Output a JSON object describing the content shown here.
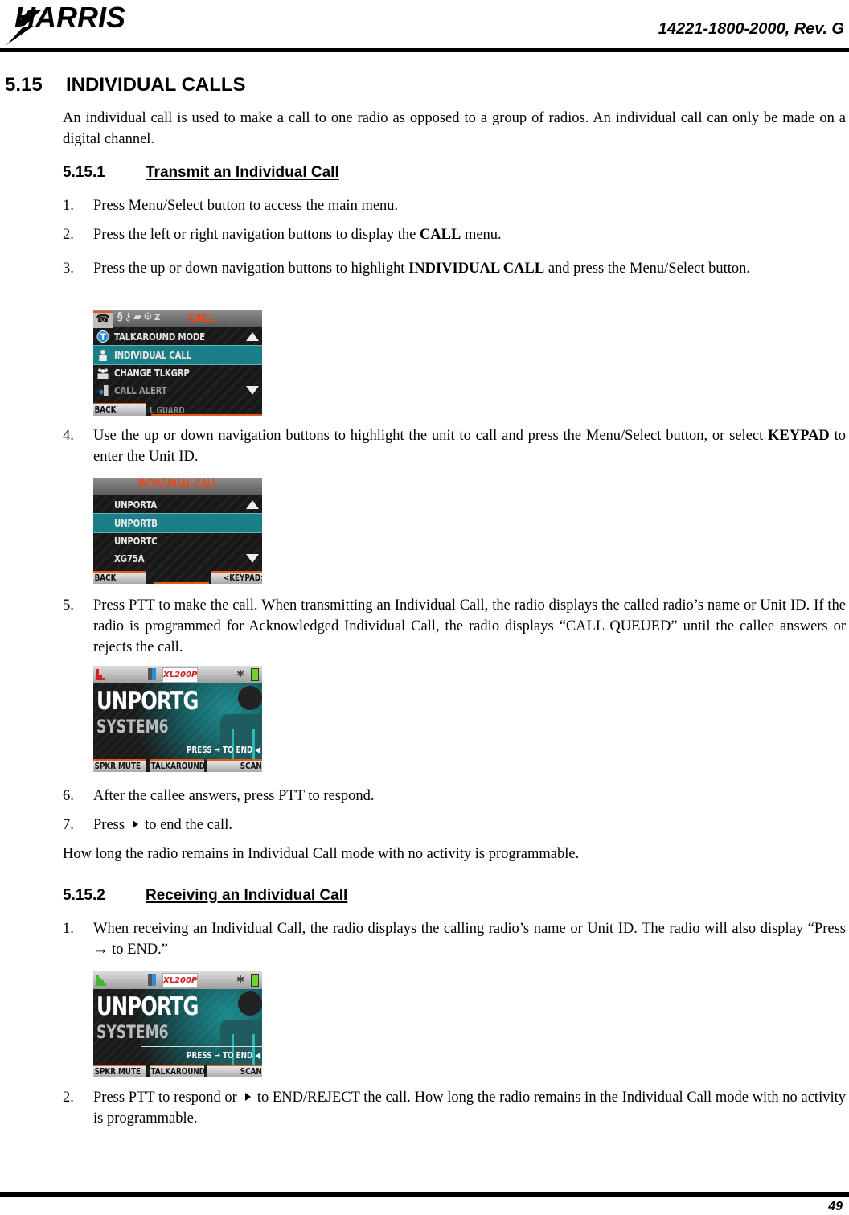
{
  "header": {
    "logo_text": "HARRIS",
    "doc_number": "14221-1800-2000, Rev. G"
  },
  "footer": {
    "page_number": "49"
  },
  "section": {
    "number": "5.15",
    "title": "INDIVIDUAL CALLS",
    "intro": "An individual call is used to make a call to one radio as opposed to a group of radios. An individual call can only be made on a digital channel."
  },
  "transmit": {
    "number": "5.15.1",
    "title": "Transmit an Individual Call",
    "steps": [
      {
        "n": "1.",
        "text": "Press Menu/Select button to access the main menu."
      },
      {
        "n": "2.",
        "pre": "Press the left or right navigation buttons to display the ",
        "bold": "CALL",
        "post": " menu."
      },
      {
        "n": "3.",
        "pre": "Press the up or down navigation buttons to highlight ",
        "bold": "INDIVIDUAL CALL",
        "post": " and press the Menu/Select button."
      },
      {
        "n": "4.",
        "pre": "Use the up or down navigation buttons to highlight the unit to call and press the Menu/Select button, or select ",
        "bold": "KEYPAD",
        "post": " to enter the Unit ID."
      },
      {
        "n": "5.",
        "text": "Press PTT to make the call.  When transmitting an Individual Call, the radio displays the called radio’s name or Unit ID. If the radio is programmed for Acknowledged Individual Call, the radio displays “CALL QUEUED” until the callee answers or rejects the call."
      },
      {
        "n": "6.",
        "text": "After the callee answers, press PTT to respond."
      },
      {
        "n": "7.",
        "pre": "Press",
        "post": "to end the call."
      }
    ],
    "note": "How long the radio remains in Individual Call mode with no activity is programmable."
  },
  "receive": {
    "number": "5.15.2",
    "title": "Receiving an Individual Call",
    "steps": [
      {
        "n": "1.",
        "text": "When receiving an Individual Call, the radio displays the calling radio’s name or Unit ID. The radio will also display “Press → to END.”"
      },
      {
        "n": "2.",
        "pre": "Press PTT to respond or",
        "post": "to END/REJECT the call. How long the radio remains in the Individual Call mode with no activity is programmable."
      }
    ]
  },
  "screens": {
    "call_menu": {
      "title": "CALL",
      "tab_icons": [
        "phone-icon",
        "scan-icon",
        "key-icon",
        "message-icon",
        "gear-icon",
        "sleep-icon"
      ],
      "items": [
        {
          "label": "TALKAROUND MODE",
          "icon": "talkaround-icon",
          "selected": false
        },
        {
          "label": "INDIVIDUAL CALL",
          "icon": "person-icon",
          "selected": true
        },
        {
          "label": "CHANGE TLKGRP",
          "icon": "group-icon",
          "selected": false
        },
        {
          "label": "CALL ALERT",
          "icon": "call-alert-icon",
          "selected": false
        }
      ],
      "partial_item": "L GUARD",
      "softkeys": {
        "left": "BACK"
      }
    },
    "unit_list": {
      "title": "INDIVIDUAL CALL",
      "items": [
        {
          "label": "UNPORTA",
          "selected": false
        },
        {
          "label": "UNPORTB",
          "selected": true
        },
        {
          "label": "UNPORTC",
          "selected": false
        },
        {
          "label": "XG75A",
          "selected": false
        }
      ],
      "softkeys": {
        "left": "BACK",
        "right": "<KEYPAD>"
      }
    },
    "transmit_call": {
      "model": "XL200P",
      "unit": "UNPORTG",
      "system": "SYSTEM6",
      "prompt": "PRESS → TO END ◀",
      "signal_color": "#d42020",
      "softkeys": {
        "left": "SPKR MUTE",
        "middle": "TALKAROUND",
        "right": "SCAN"
      }
    },
    "receive_call": {
      "model": "XL200P",
      "unit": "UNPORTG",
      "system": "SYSTEM6",
      "prompt": "PRESS → TO END ◀",
      "signal_color": "#3fb82e",
      "softkeys": {
        "left": "SPKR MUTE",
        "middle": "TALKAROUND",
        "right": "SCAN"
      }
    }
  }
}
